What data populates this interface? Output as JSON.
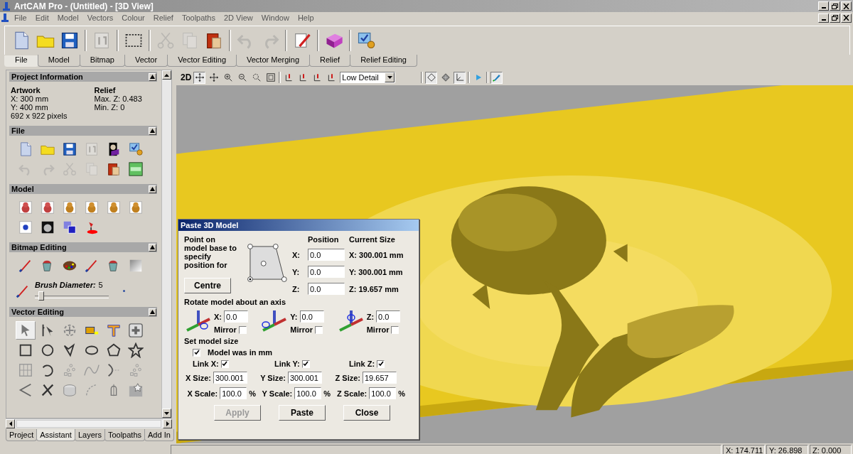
{
  "window": {
    "title": "ArtCAM Pro - (Untitled) - [3D View]"
  },
  "menu": [
    "File",
    "Edit",
    "Model",
    "Vectors",
    "Colour",
    "Relief",
    "Toolpaths",
    "2D View",
    "Window",
    "Help"
  ],
  "toolbar": [
    {
      "disabled": false
    },
    {
      "disabled": false
    },
    {
      "disabled": false
    },
    {
      "disabled": true
    },
    {
      "disabled": false
    },
    {
      "disabled": true
    },
    {
      "disabled": true
    },
    {
      "disabled": false
    },
    {
      "disabled": true
    },
    {
      "disabled": true
    },
    {
      "disabled": false
    },
    {
      "disabled": false
    },
    {
      "disabled": false
    }
  ],
  "ribbon_tabs": [
    {
      "label": "File",
      "selected": true
    },
    {
      "label": "Model",
      "selected": false
    },
    {
      "label": "Bitmap",
      "selected": false
    },
    {
      "label": "Vector",
      "selected": false
    },
    {
      "label": "Vector Editing",
      "selected": false
    },
    {
      "label": "Vector Merging",
      "selected": false
    },
    {
      "label": "Relief",
      "selected": false
    },
    {
      "label": "Relief Editing",
      "selected": false
    }
  ],
  "panel": {
    "sections": [
      {
        "kind": "info",
        "title": "Project Information",
        "columns": [
          {
            "heading": "Artwork",
            "lines": [
              "X: 300 mm",
              "Y: 400 mm",
              "692 x 922 pixels"
            ]
          },
          {
            "heading": "Relief",
            "lines": [
              "Max. Z: 0.483",
              "Min. Z: 0"
            ]
          }
        ]
      },
      {
        "kind": "icons",
        "title": "File",
        "icons": [
          {
            "disabled": false
          },
          {
            "disabled": false
          },
          {
            "disabled": false
          },
          {
            "disabled": true
          },
          {
            "disabled": false
          },
          {
            "disabled": false
          },
          {
            "disabled": true
          },
          {
            "disabled": true
          },
          {
            "disabled": true
          },
          {
            "disabled": true
          },
          {
            "disabled": false
          },
          {
            "disabled": false
          }
        ]
      },
      {
        "kind": "icons",
        "title": "Model",
        "icons": [
          {
            "disabled": false
          },
          {
            "disabled": false
          },
          {
            "disabled": false
          },
          {
            "disabled": false
          },
          {
            "disabled": false
          },
          {
            "disabled": false
          },
          {
            "disabled": false
          },
          {
            "disabled": false
          },
          {
            "disabled": false
          },
          {
            "disabled": false
          }
        ]
      },
      {
        "kind": "brush",
        "title": "Bitmap Editing",
        "icons": [
          {
            "disabled": false
          },
          {
            "disabled": false
          },
          {
            "disabled": false
          },
          {
            "disabled": false
          },
          {
            "disabled": false
          },
          {
            "disabled": false
          }
        ],
        "brush_label": "Brush Diameter:",
        "brush_value": "5",
        "level": 0.05
      },
      {
        "kind": "tools",
        "title": "Vector Editing",
        "tools": [
          {
            "selected": true
          },
          {
            "selected": false
          },
          {
            "selected": false
          },
          {
            "selected": false
          },
          {
            "selected": false
          },
          {
            "selected": false
          },
          {
            "selected": false
          },
          {
            "selected": false
          },
          {
            "selected": false
          },
          {
            "selected": false
          },
          {
            "selected": false
          },
          {
            "selected": false
          },
          {
            "selected": false
          },
          {
            "selected": false
          },
          {
            "selected": false
          },
          {
            "selected": false
          },
          {
            "selected": false
          },
          {
            "selected": false
          },
          {
            "selected": false
          },
          {
            "selected": false
          },
          {
            "selected": false
          },
          {
            "selected": false
          },
          {
            "selected": false
          },
          {
            "selected": false
          }
        ]
      }
    ]
  },
  "bottom_tabs": [
    {
      "label": "Project",
      "selected": false
    },
    {
      "label": "Assistant",
      "selected": true
    },
    {
      "label": "Layers",
      "selected": false
    },
    {
      "label": "Toolpaths",
      "selected": false
    },
    {
      "label": "Add In",
      "selected": false
    }
  ],
  "view_toolbar": {
    "mode": "2D",
    "detail": "Low Detail",
    "tools": [
      {
        "on": true
      },
      {
        "on": false
      },
      {
        "on": false
      },
      {
        "on": false
      },
      {
        "on": false
      },
      {
        "on": false
      },
      {
        "on": false
      },
      {
        "on": false
      },
      {
        "on": false
      },
      {
        "on": false
      }
    ],
    "display": [
      {
        "on": true
      },
      {
        "on": false
      },
      {
        "on": true
      },
      {
        "on": false
      },
      {
        "on": true
      }
    ]
  },
  "dialog": {
    "title": "Paste 3D Model",
    "point_label": "Point on model base to specify position for",
    "anchors": [
      {
        "selected": false
      },
      {
        "selected": false
      },
      {
        "selected": false
      },
      {
        "selected": true
      },
      {
        "selected": false
      }
    ],
    "centre_button": "Centre",
    "position_heading": "Position",
    "size_heading": "Current Size",
    "position": [
      {
        "label": "X:",
        "value": "0.0",
        "size": "X: 300.001 mm"
      },
      {
        "label": "Y:",
        "value": "0.0",
        "size": "Y: 300.001 mm"
      },
      {
        "label": "Z:",
        "value": "0.0",
        "size": "Z: 19.657 mm"
      }
    ],
    "rotate_heading": "Rotate model about an axis",
    "rotate": [
      {
        "label": "X:",
        "value": "0.0",
        "mirror_label": "Mirror",
        "mirror": false
      },
      {
        "label": "Y:",
        "value": "0.0",
        "mirror_label": "Mirror",
        "mirror": false
      },
      {
        "label": "Z:",
        "value": "0.0",
        "mirror_label": "Mirror",
        "mirror": false
      }
    ],
    "model_size_heading": "Set model size",
    "units": {
      "label": "Model was in mm",
      "checked": true
    },
    "axes": [
      {
        "link_label": "Link X:",
        "linked": true,
        "size_label": "X Size:",
        "size": "300.001",
        "scale_label": "X Scale:",
        "scale": "100.0",
        "unit": "%"
      },
      {
        "link_label": "Link Y:",
        "linked": true,
        "size_label": "Y Size:",
        "size": "300.001",
        "scale_label": "Y Scale:",
        "scale": "100.0",
        "unit": "%"
      },
      {
        "link_label": "Link Z:",
        "linked": true,
        "size_label": "Z Size:",
        "size": "19.657",
        "scale_label": "Z Scale:",
        "scale": "100.0",
        "unit": "%"
      }
    ],
    "buttons": [
      {
        "label": "Apply",
        "disabled": true
      },
      {
        "label": "Paste",
        "disabled": false
      },
      {
        "label": "Close",
        "disabled": false
      }
    ]
  },
  "status_bar": [
    "X: 174.711",
    "Y: 26.898",
    "Z: 0.000"
  ]
}
